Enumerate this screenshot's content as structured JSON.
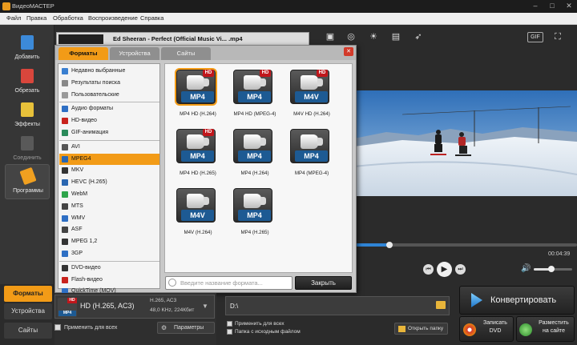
{
  "window": {
    "title": "ВидеоМАСТЕР",
    "minimize": "–",
    "maximize": "□",
    "close": "✕"
  },
  "menu": [
    "Файл",
    "Правка",
    "Обработка",
    "Воспроизведение",
    "Справка"
  ],
  "toolbar": [
    {
      "label": "Добавить",
      "icon": "add-film-icon",
      "color": "#3c8ad9"
    },
    {
      "label": "Обрезать",
      "icon": "cut-film-icon",
      "color": "#d9463c"
    },
    {
      "label": "Эффекты",
      "icon": "effects-icon",
      "color": "#e8c13a"
    },
    {
      "label": "Соединить",
      "icon": "join-icon",
      "color": "#777777"
    },
    {
      "label": "Программы",
      "icon": "programs-icon",
      "color": "#f0a020"
    }
  ],
  "left_tabs": [
    "Форматы",
    "Устройства",
    "Сайты"
  ],
  "file": {
    "name": "Ed Sheeran - Perfect (Official Music Vi... .mp4"
  },
  "dialog": {
    "tabs": [
      "Форматы",
      "Устройства",
      "Сайты"
    ],
    "close": "✕",
    "categories": [
      {
        "label": "Недавно выбранные",
        "color": "#3a7fd0"
      },
      {
        "label": "Результаты поиска",
        "color": "#888888"
      },
      {
        "label": "Пользовательские",
        "color": "#999999"
      },
      {
        "sep": true
      },
      {
        "label": "Аудио форматы",
        "color": "#2e6fc4"
      },
      {
        "label": "HD-видео",
        "color": "#c8221c"
      },
      {
        "label": "GIF-анимация",
        "color": "#2a8a5a"
      },
      {
        "sep": true
      },
      {
        "label": "AVI",
        "color": "#555555"
      },
      {
        "label": "MPEG4",
        "color": "#2a66b0",
        "selected": true
      },
      {
        "label": "MKV",
        "color": "#333333"
      },
      {
        "label": "HEVC (H.265)",
        "color": "#2a66b0"
      },
      {
        "label": "WebM",
        "color": "#2ea44a"
      },
      {
        "label": "MTS",
        "color": "#444444"
      },
      {
        "label": "WMV",
        "color": "#2e6fc4"
      },
      {
        "label": "ASF",
        "color": "#444444"
      },
      {
        "label": "MPEG 1,2",
        "color": "#333333"
      },
      {
        "label": "3GP",
        "color": "#2e6fc4"
      },
      {
        "sep": true
      },
      {
        "label": "DVD-видео",
        "color": "#333333"
      },
      {
        "label": "Flash-видео",
        "color": "#c8221c"
      },
      {
        "label": "QuickTime (MOV)",
        "color": "#2e6fc4"
      }
    ],
    "formats": [
      {
        "name": "MP4",
        "hd": true,
        "label": "MP4 HD (H.264)",
        "selected": true
      },
      {
        "name": "MP4",
        "hd": true,
        "label": "MP4 HD (MPEG-4)"
      },
      {
        "name": "M4V",
        "hd": true,
        "label": "M4V HD (H.264)"
      },
      {
        "name": "MP4",
        "hd": true,
        "label": "MP4 HD (H.265)"
      },
      {
        "name": "MP4",
        "hd": false,
        "label": "MP4 (H.264)"
      },
      {
        "name": "MP4",
        "hd": false,
        "label": "MP4 (MPEG-4)"
      },
      {
        "name": "M4V",
        "hd": false,
        "label": "M4V (H.264)"
      },
      {
        "name": "MP4",
        "hd": false,
        "label": "MP4 (H.265)"
      }
    ],
    "hd_badge": "HD",
    "search_placeholder": "Введите название формата...",
    "close_button": "Закрыть"
  },
  "player": {
    "time": "00:04:39"
  },
  "output": {
    "badge_top": "HD",
    "badge_bottom": "MP4",
    "format_name": "HD (H.265, AC3)",
    "codec": "H.265, AC3",
    "details": "48,0 KHz, 224Кбит",
    "apply_all": "Применить для всех",
    "params": "Параметры",
    "path": "D:\\",
    "apply_all_right": "Применить для всех",
    "source_folder": "Папка с исходным файлом",
    "open_folder": "Открыть папку"
  },
  "actions": {
    "convert": "Конвертировать",
    "burn_dvd_1": "Записать",
    "burn_dvd_2": "DVD",
    "publish_1": "Разместить",
    "publish_2": "на сайте"
  }
}
